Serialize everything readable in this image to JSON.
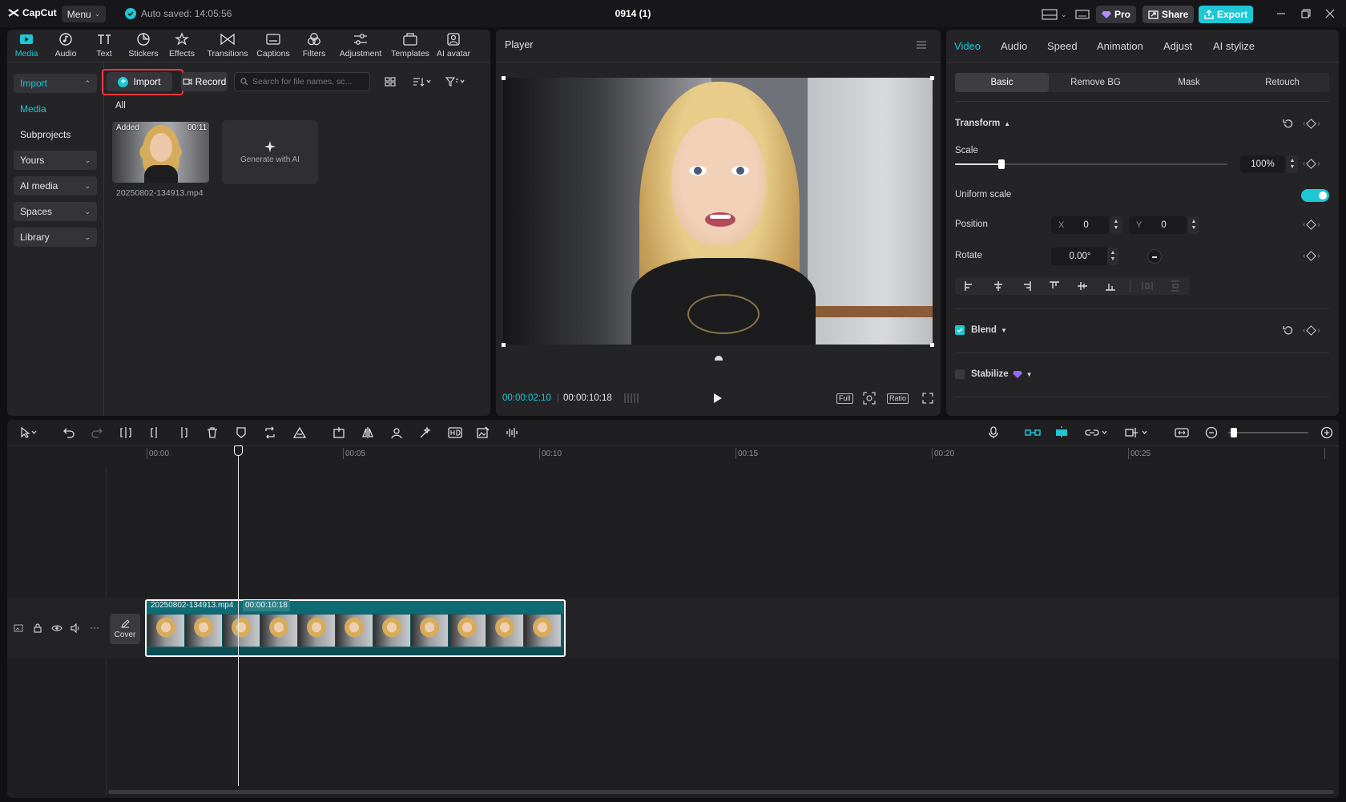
{
  "app": {
    "logo_text": "CapCut",
    "menu_label": "Menu",
    "autosave_text": "Auto saved: 14:05:56",
    "project_title": "0914 (1)",
    "pro_label": "Pro",
    "share_label": "Share",
    "export_label": "Export"
  },
  "toolbar": {
    "tools": [
      {
        "label": "Media",
        "icon": "media-icon",
        "active": true
      },
      {
        "label": "Audio",
        "icon": "audio-icon"
      },
      {
        "label": "Text",
        "icon": "text-icon"
      },
      {
        "label": "Stickers",
        "icon": "stickers-icon"
      },
      {
        "label": "Effects",
        "icon": "effects-icon"
      },
      {
        "label": "Transitions",
        "icon": "transitions-icon"
      },
      {
        "label": "Captions",
        "icon": "captions-icon"
      },
      {
        "label": "Filters",
        "icon": "filters-icon"
      },
      {
        "label": "Adjustment",
        "icon": "adjustment-icon"
      },
      {
        "label": "Templates",
        "icon": "templates-icon"
      },
      {
        "label": "AI avatar",
        "icon": "ai-avatar-icon"
      }
    ]
  },
  "sidebar": {
    "import_label": "Import",
    "media_label": "Media",
    "subprojects_label": "Subprojects",
    "yours_label": "Yours",
    "ai_media_label": "AI media",
    "spaces_label": "Spaces",
    "library_label": "Library"
  },
  "media": {
    "import_button": "Import",
    "record_button": "Record",
    "search_placeholder": "Search for file names, sc...",
    "filter_all": "All",
    "item": {
      "badge": "Added",
      "duration": "00:11",
      "filename": "20250802-134913.mp4"
    },
    "generate_label": "Generate with AI"
  },
  "player": {
    "title": "Player",
    "current_time": "00:00:02:10",
    "total_time": "00:00:10:18",
    "full_label": "Full",
    "ratio_label": "Ratio"
  },
  "properties": {
    "tabs": [
      "Video",
      "Audio",
      "Speed",
      "Animation",
      "Adjust",
      "AI stylize"
    ],
    "subtabs": [
      "Basic",
      "Remove BG",
      "Mask",
      "Retouch"
    ],
    "transform_label": "Transform",
    "scale_label": "Scale",
    "scale_value": "100%",
    "scale_level": 0.17,
    "uniform_scale_label": "Uniform scale",
    "position_label": "Position",
    "x_label": "X",
    "x_value": "0",
    "y_label": "Y",
    "y_value": "0",
    "rotate_label": "Rotate",
    "rotate_value": "0.00°",
    "blend_label": "Blend",
    "stabilize_label": "Stabilize"
  },
  "timeline": {
    "ticks": [
      "00:00",
      "00:05",
      "00:10",
      "00:15",
      "00:20",
      "00:25"
    ],
    "clip_name": "20250802-134913.mp4",
    "clip_duration": "00:00:10:18",
    "cover_label": "Cover"
  },
  "colors": {
    "accent": "#1fc7d4",
    "highlight": "#e8383e",
    "panel": "#242427"
  }
}
